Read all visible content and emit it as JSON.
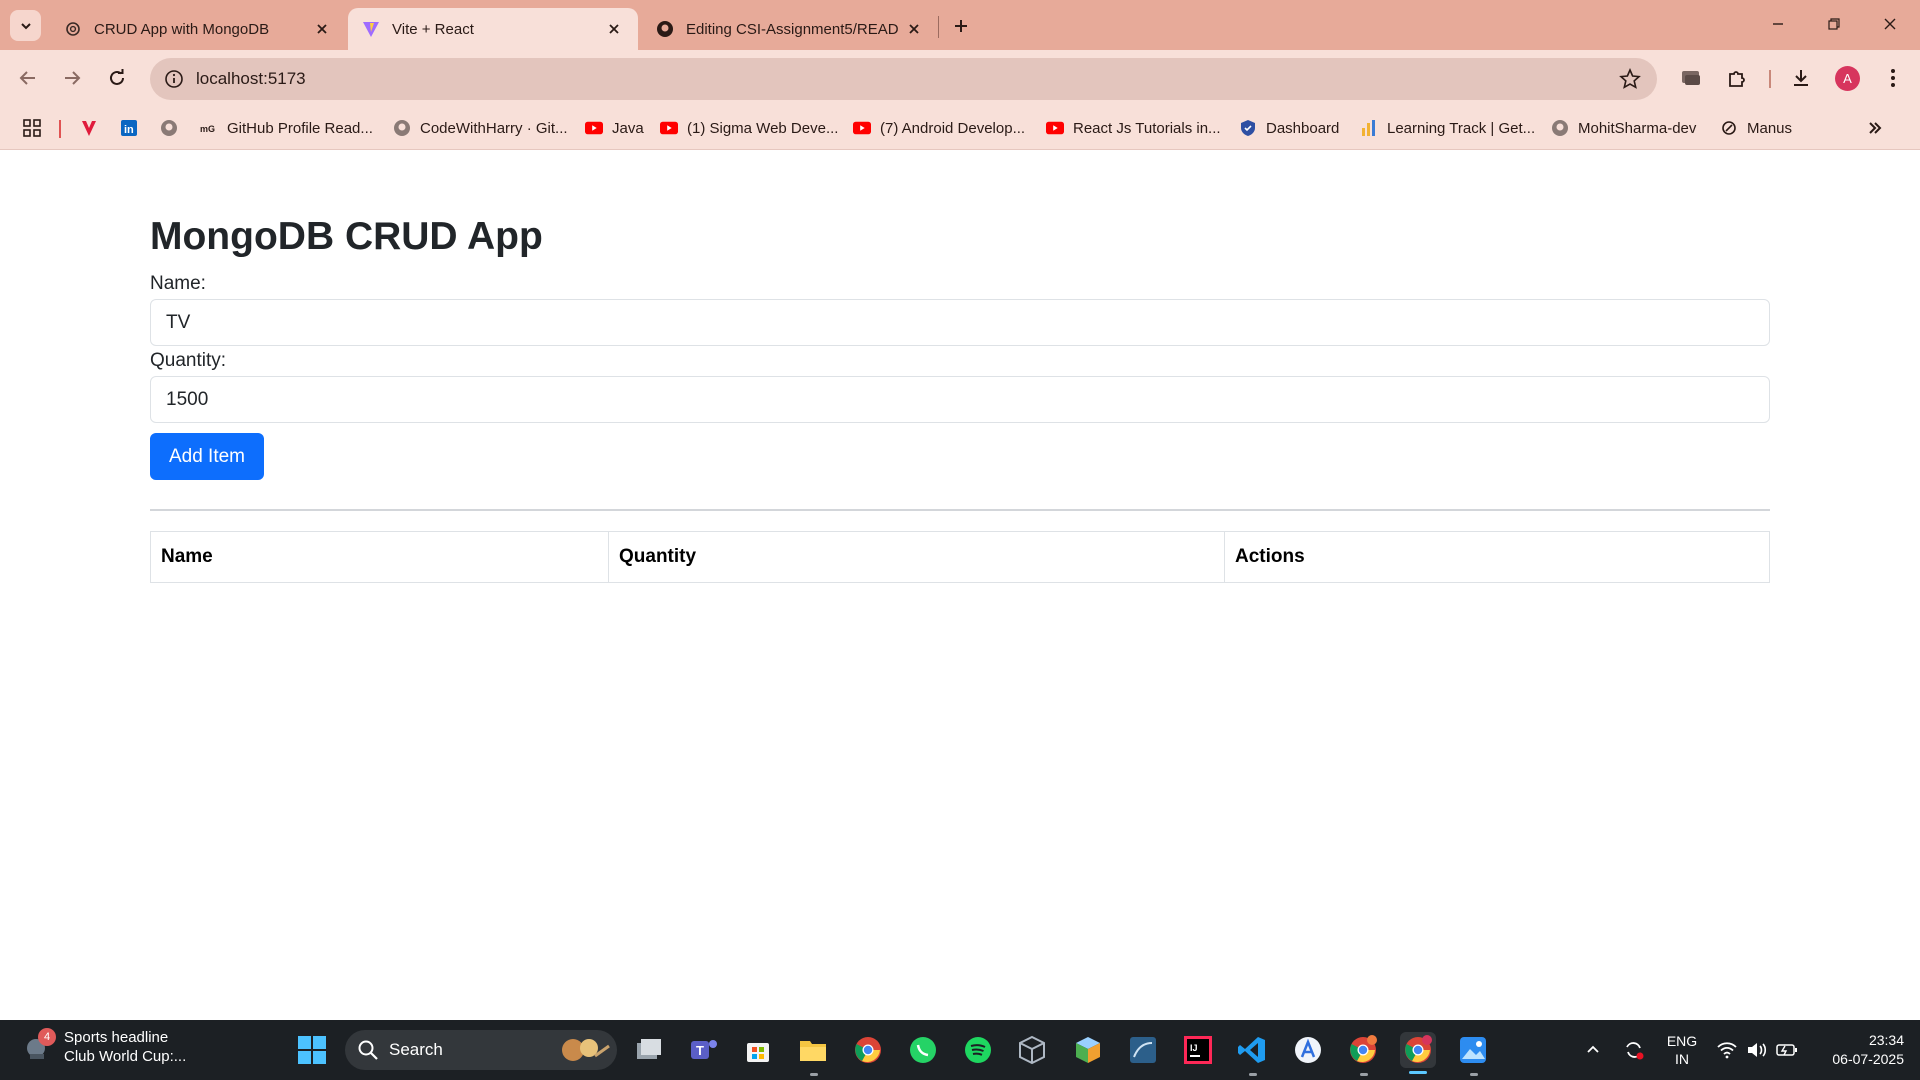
{
  "browser": {
    "tabs": [
      {
        "title": "CRUD App with MongoDB",
        "icon": "openai-icon"
      },
      {
        "title": "Vite + React",
        "icon": "vite-icon"
      },
      {
        "title": "Editing CSI-Assignment5/READ",
        "icon": "github-icon"
      }
    ],
    "url": "localhost:5173",
    "profile_initial": "A",
    "bookmarks": [
      {
        "label": "",
        "icon": "apps-grid-icon"
      },
      {
        "label": "",
        "icon": "vercel-v-icon"
      },
      {
        "label": "",
        "icon": "linkedin-icon"
      },
      {
        "label": "",
        "icon": "github-icon"
      },
      {
        "label": "GitHub Profile Read...",
        "icon": "mg-icon"
      },
      {
        "label": "CodeWithHarry · Git...",
        "icon": "github-icon"
      },
      {
        "label": "Java",
        "icon": "youtube-icon"
      },
      {
        "label": "(1) Sigma Web Deve...",
        "icon": "youtube-icon"
      },
      {
        "label": "(7) Android Develop...",
        "icon": "youtube-icon"
      },
      {
        "label": "React Js Tutorials in...",
        "icon": "youtube-icon"
      },
      {
        "label": "Dashboard",
        "icon": "shield-icon"
      },
      {
        "label": "Learning Track | Get...",
        "icon": "chart-icon"
      },
      {
        "label": "MohitSharma-dev",
        "icon": "github-icon"
      },
      {
        "label": "Manus",
        "icon": "manus-icon"
      }
    ],
    "colors": {
      "frame": "#e7aa99",
      "toolbar": "#f8e0d9",
      "omnibox": "#e3c5bd"
    }
  },
  "app": {
    "title": "MongoDB CRUD App",
    "form": {
      "name_label": "Name:",
      "name_value": "TV",
      "quantity_label": "Quantity:",
      "quantity_value": "1500",
      "submit_label": "Add Item"
    },
    "table": {
      "columns": [
        "Name",
        "Quantity",
        "Actions"
      ],
      "rows": []
    },
    "colors": {
      "primary": "#0d6efd"
    }
  },
  "taskbar": {
    "news": {
      "badge": "4",
      "line1": "Sports headline",
      "line2": "Club World Cup:..."
    },
    "search_placeholder": "Search",
    "apps": [
      "windows-start-icon",
      "search-icon",
      "task-view-icon",
      "teams-icon",
      "microsoft-store-icon",
      "file-explorer-icon",
      "chrome-icon",
      "whatsapp-icon",
      "spotify-icon",
      "virtualbox-icon",
      "cube-app-icon",
      "mysql-workbench-icon",
      "intellij-icon",
      "vscode-icon",
      "app-store-a-icon",
      "chrome-profile-icon",
      "chrome-active-icon",
      "photos-icon"
    ],
    "tray": {
      "language_line1": "ENG",
      "language_line2": "IN",
      "time": "23:34",
      "date": "06-07-2025"
    }
  }
}
